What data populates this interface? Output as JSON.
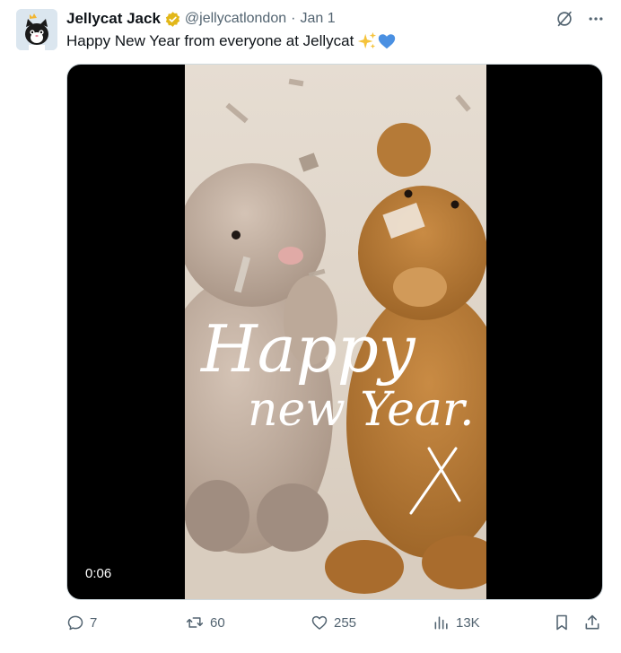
{
  "author": {
    "name": "Jellycat Jack",
    "handle": "@jellycatlondon",
    "separator": "·",
    "date": "Jan 1",
    "verified_color": "#e2b719"
  },
  "tweet": {
    "text": "Happy New Year from everyone at Jellycat",
    "emoji": [
      "sparkles",
      "blue-heart"
    ]
  },
  "media": {
    "type": "video",
    "duration": "0:06",
    "overlay_text": [
      "Happy",
      "new Year."
    ]
  },
  "actions": {
    "replies": "7",
    "reposts": "60",
    "likes": "255",
    "views": "13K"
  },
  "icons": {
    "top_right": [
      "grok-icon",
      "more-icon"
    ],
    "bottom_right": [
      "bookmark-icon",
      "share-icon"
    ]
  },
  "colors": {
    "text": "#0f1419",
    "secondary": "#536471",
    "heart": "#4a90e2"
  }
}
